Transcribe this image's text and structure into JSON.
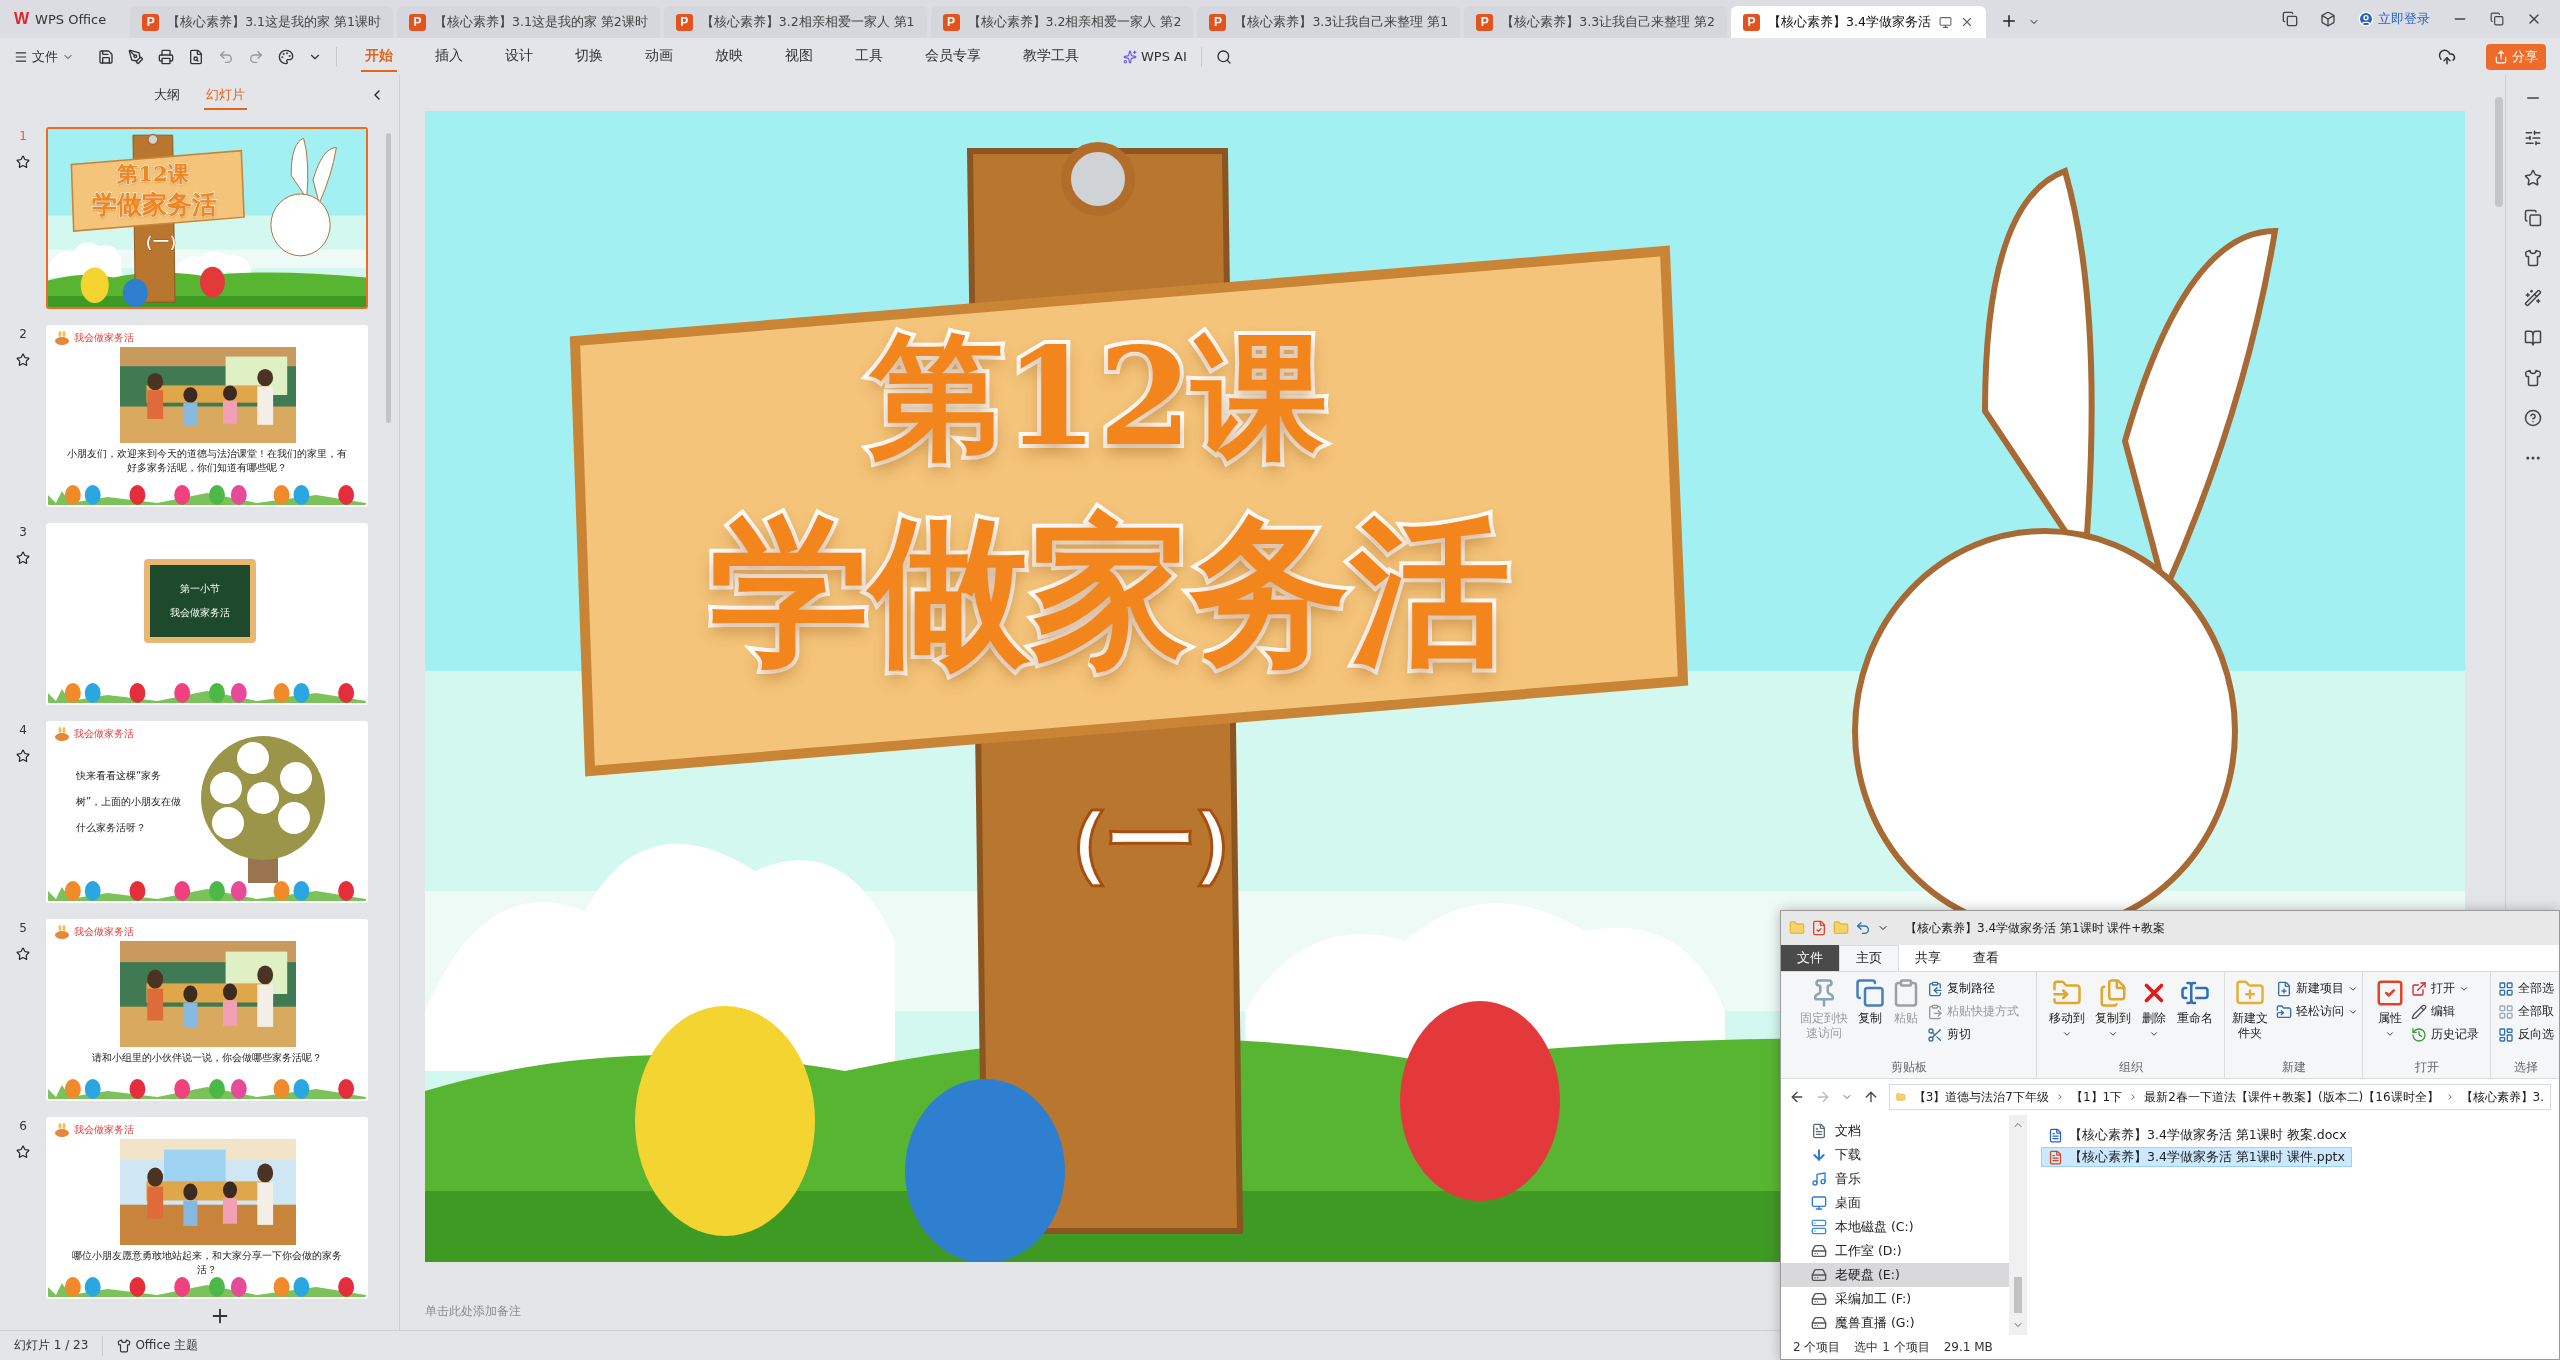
{
  "app": {
    "logo_mark": "W",
    "logo_text": "WPS Office"
  },
  "doc_tabs": [
    {
      "icon": "P",
      "title": "【核心素养】3.1这是我的家 第1课时",
      "selected": false
    },
    {
      "icon": "P",
      "title": "【核心素养】3.1这是我的家 第2课时",
      "selected": false
    },
    {
      "icon": "P",
      "title": "【核心素养】3.2相亲相爱一家人 第1",
      "selected": false
    },
    {
      "icon": "P",
      "title": "【核心素养】3.2相亲相爱一家人 第2",
      "selected": false
    },
    {
      "icon": "P",
      "title": "【核心素养】3.3让我自己来整理 第1",
      "selected": false
    },
    {
      "icon": "P",
      "title": "【核心素养】3.3让我自己来整理 第2",
      "selected": false
    },
    {
      "icon": "P",
      "title": "【核心素养】3.4学做家务活",
      "selected": true
    }
  ],
  "login": "立即登录",
  "file_menu": "文件",
  "ribbon_tabs": [
    {
      "label": "开始",
      "selected": true
    },
    {
      "label": "插入",
      "selected": false
    },
    {
      "label": "设计",
      "selected": false
    },
    {
      "label": "切换",
      "selected": false
    },
    {
      "label": "动画",
      "selected": false
    },
    {
      "label": "放映",
      "selected": false
    },
    {
      "label": "视图",
      "selected": false
    },
    {
      "label": "工具",
      "selected": false
    },
    {
      "label": "会员专享",
      "selected": false
    },
    {
      "label": "教学工具",
      "selected": false
    }
  ],
  "ai_label": "WPS AI",
  "share": "分享",
  "panel_tabs": [
    {
      "label": "大纲",
      "selected": false
    },
    {
      "label": "幻灯片",
      "selected": true
    }
  ],
  "slides": [
    {
      "number": "1",
      "kind": "title",
      "selected": true,
      "title": "第12课",
      "subtitle": "学做家务活",
      "part": "（一）"
    },
    {
      "number": "2",
      "selected": false,
      "header": "我会做家务活",
      "caption": "小朋友们，欢迎来到今天的道德与法治课堂！在我们的家里，有好多家务活呢，你们知道有哪些呢？"
    },
    {
      "number": "3",
      "kind": "board",
      "selected": false,
      "lines": [
        "第一小节",
        "我会做家务活"
      ]
    },
    {
      "number": "4",
      "kind": "tree",
      "selected": false,
      "header": "我会做家务活",
      "caption": "快来看看这棵“家务树”，上面的小朋友在做什么家务活呀？"
    },
    {
      "number": "5",
      "selected": false,
      "header": "我会做家务活",
      "caption": "请和小组里的小伙伴说一说，你会做哪些家务活呢？"
    },
    {
      "number": "6",
      "selected": false,
      "header": "我会做家务活",
      "caption": "哪位小朋友愿意勇敢地站起来，和大家分享一下你会做的家务活？"
    }
  ],
  "slide": {
    "title": "第12课",
    "subtitle": "学做家务活",
    "part": "（一）"
  },
  "notes_placeholder": "单击此处添加备注",
  "status_bar": {
    "slide_counter": "幻灯片 1 / 23",
    "theme": "Office 主题"
  },
  "explorer": {
    "title": "【核心素养】3.4学做家务活 第1课时 课件+教案",
    "tabs": [
      {
        "label": "文件",
        "kind": "file",
        "selected": false
      },
      {
        "label": "主页",
        "kind": "tab",
        "selected": true
      },
      {
        "label": "共享",
        "kind": "tab",
        "selected": false
      },
      {
        "label": "查看",
        "kind": "tab",
        "selected": false
      }
    ],
    "groups": [
      {
        "label": "剪贴板",
        "large": [
          {
            "label": "固定到快速访问",
            "disabled": true,
            "dropdown": false
          },
          {
            "label": "复制",
            "disabled": false,
            "dropdown": false
          },
          {
            "label": "粘贴",
            "disabled": true,
            "dropdown": false
          }
        ],
        "small": [
          {
            "label": "复制路径",
            "disabled": false,
            "dropdown": false
          },
          {
            "label": "粘贴快捷方式",
            "disabled": true,
            "dropdown": false
          },
          {
            "label": "剪切",
            "disabled": false,
            "dropdown": false
          }
        ]
      },
      {
        "label": "组织",
        "large": [
          {
            "label": "移动到",
            "disabled": false,
            "dropdown": true
          },
          {
            "label": "复制到",
            "disabled": false,
            "dropdown": true
          },
          {
            "label": "删除",
            "disabled": false,
            "dropdown": true
          },
          {
            "label": "重命名",
            "disabled": false,
            "dropdown": false
          }
        ]
      },
      {
        "label": "新建",
        "large": [
          {
            "label": "新建文件夹",
            "disabled": false,
            "dropdown": false
          }
        ],
        "small": [
          {
            "label": "新建项目",
            "disabled": false,
            "dropdown": true
          },
          {
            "label": "轻松访问",
            "disabled": false,
            "dropdown": true
          }
        ]
      },
      {
        "label": "打开",
        "large": [
          {
            "label": "属性",
            "disabled": false,
            "dropdown": true
          }
        ],
        "small": [
          {
            "label": "打开",
            "disabled": false,
            "dropdown": true
          },
          {
            "label": "编辑",
            "disabled": false,
            "dropdown": false
          },
          {
            "label": "历史记录",
            "disabled": false,
            "dropdown": false
          }
        ]
      },
      {
        "label": "选择",
        "small": [
          {
            "label": "全部选",
            "disabled": false,
            "dropdown": false
          },
          {
            "label": "全部取",
            "disabled": false,
            "dropdown": false
          },
          {
            "label": "反向选",
            "disabled": false,
            "dropdown": false
          }
        ]
      }
    ],
    "path": [
      "【3】道德与法治7下年级",
      "【1】1下",
      "最新2春一下道法【课件+教案】(版本二)【16课时全】",
      "【核心素养】3."
    ],
    "nav": [
      {
        "label": "文档",
        "selected": false
      },
      {
        "label": "下载",
        "selected": false
      },
      {
        "label": "音乐",
        "selected": false
      },
      {
        "label": "桌面",
        "selected": false
      },
      {
        "label": "本地磁盘 (C:)",
        "selected": false
      },
      {
        "label": "工作室 (D:)",
        "selected": false
      },
      {
        "label": "老硬盘 (E:)",
        "selected": true
      },
      {
        "label": "采编加工 (F:)",
        "selected": false
      },
      {
        "label": "魔兽直播 (G:)",
        "selected": false
      }
    ],
    "files": [
      {
        "name": "【核心素养】3.4学做家务活 第1课时 教案.docx",
        "kind": "word",
        "selected": false
      },
      {
        "name": "【核心素养】3.4学做家务活 第1课时 课件.pptx",
        "kind": "powerpoint",
        "selected": true
      }
    ],
    "status": [
      "2 个项目",
      "选中 1 个项目",
      "29.1 MB"
    ]
  }
}
